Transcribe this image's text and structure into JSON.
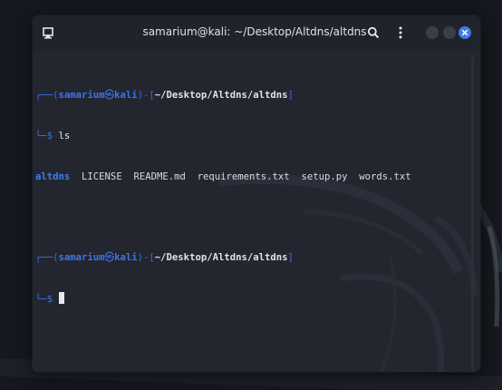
{
  "window": {
    "title": "samarium@kali: ~/Desktop/Altdns/altdns"
  },
  "icons": {
    "terminal": "terminal-icon",
    "search": "search-icon",
    "menu": "kebab-menu-icon",
    "minimize": "minimize-icon",
    "maximize": "maximize-icon",
    "close": "close-icon"
  },
  "colors": {
    "terminal_bg": "#23262f",
    "prompt_blue": "#3f74ea",
    "directory_blue": "#3f7ef0",
    "close_button": "#3e7be6"
  },
  "terminal": {
    "prompt1": {
      "frame_start": "┌──(",
      "user": "samarium",
      "at": "㉿",
      "host": "kali",
      "frame_mid": ")-[",
      "path": "~/Desktop/Altdns/altdns",
      "frame_end": "]",
      "frame_cmd": "└─",
      "symbol": "$",
      "command": "ls"
    },
    "ls_output": {
      "directory": "altdns",
      "files": [
        "LICENSE",
        "README.md",
        "requirements.txt",
        "setup.py",
        "words.txt"
      ]
    },
    "prompt2": {
      "frame_start": "┌──(",
      "user": "samarium",
      "at": "㉿",
      "host": "kali",
      "frame_mid": ")-[",
      "path": "~/Desktop/Altdns/altdns",
      "frame_end": "]",
      "frame_cmd": "└─",
      "symbol": "$"
    }
  }
}
